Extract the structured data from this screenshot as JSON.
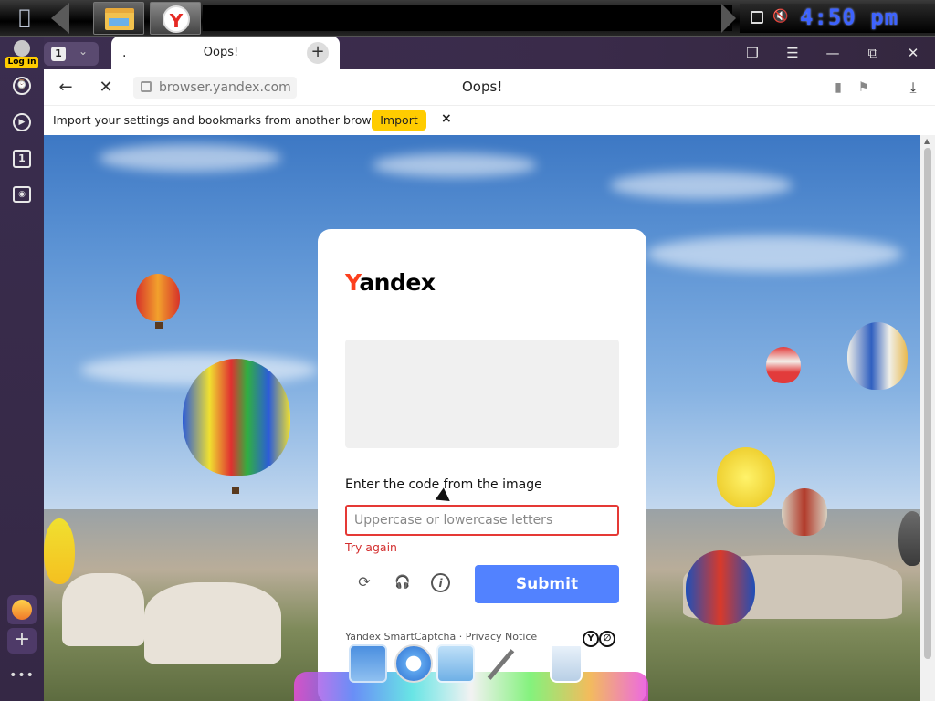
{
  "taskbar": {
    "clock": "4:50 pm",
    "icons": [
      "apple-icon",
      "files-icon",
      "yandex-browser-icon",
      "network-icon",
      "volume-muted-icon"
    ]
  },
  "sidebar": {
    "login_label": "Log in",
    "tab_count_icon_label": "1",
    "more_label": "•••"
  },
  "tabs": {
    "count": "1",
    "active": {
      "favicon_text": ".",
      "title": "Oops!"
    }
  },
  "addressbar": {
    "url": "browser.yandex.com",
    "page_title": "Oops!"
  },
  "import_bar": {
    "message": "Import your settings and bookmarks from another browser.",
    "button": "Import"
  },
  "captcha": {
    "brand_first": "Y",
    "brand_rest": "andex",
    "prompt": "Enter the code from the image",
    "input_placeholder": "Uppercase or lowercase letters",
    "input_value": "",
    "error": "Try again",
    "submit": "Submit",
    "footer": "Yandex SmartCaptcha · Privacy Notice",
    "tools": [
      "refresh-icon",
      "audio-headphones-icon",
      "info-icon"
    ]
  },
  "colors": {
    "accent_yellow": "#ffcc00",
    "submit_blue": "#5282ff",
    "error_red": "#e53935",
    "brand_red": "#fc3f1d",
    "sidebar_purple": "#3a2d4e"
  }
}
